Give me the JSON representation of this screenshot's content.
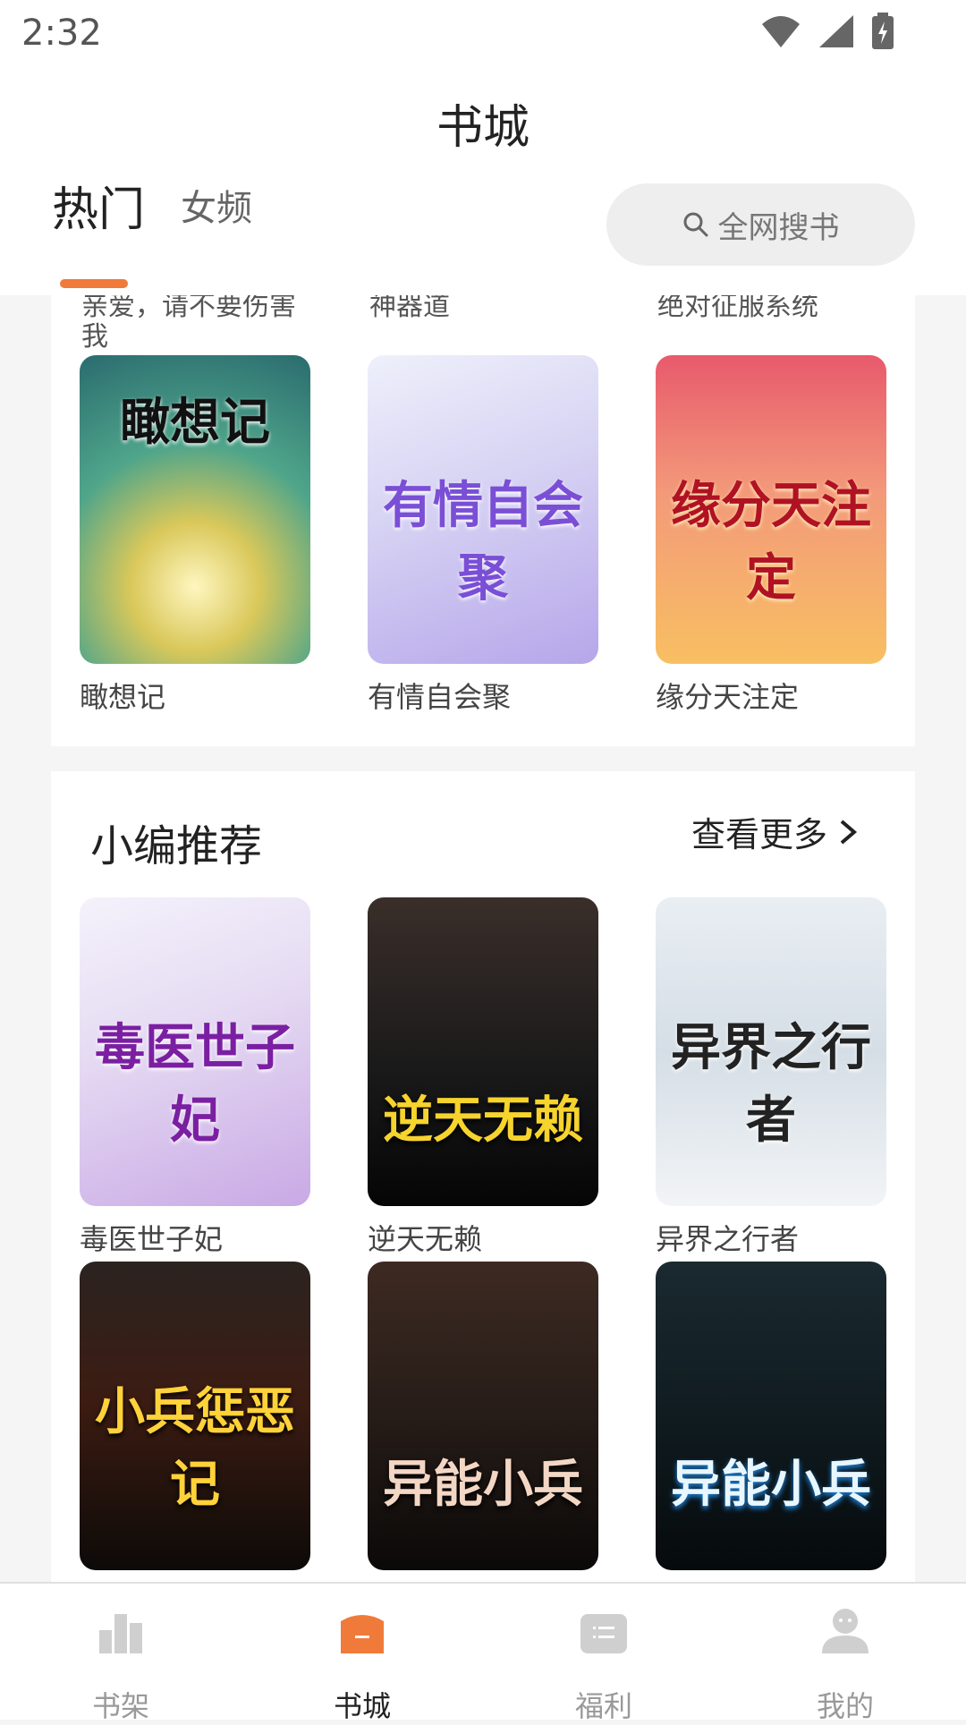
{
  "status": {
    "time": "2:32"
  },
  "header": {
    "title": "书城"
  },
  "tabs": [
    {
      "label": "热门",
      "active": true
    },
    {
      "label": "女频",
      "active": false
    }
  ],
  "search": {
    "label": "全网搜书"
  },
  "prev_section": {
    "partial_titles": [
      "亲爱，请不要伤害我",
      "神器道",
      "绝对征服系统"
    ],
    "books": [
      {
        "title": "瞰想记",
        "cover_text": "瞰想记"
      },
      {
        "title": "有情自会聚",
        "cover_text": "有情自会聚"
      },
      {
        "title": "缘分天注定",
        "cover_text": "缘分天注定"
      }
    ]
  },
  "editor_picks": {
    "title": "小编推荐",
    "more_label": "查看更多",
    "books": [
      {
        "title": "毒医世子妃",
        "cover_text": "毒医世子妃"
      },
      {
        "title": "逆天无赖",
        "cover_text": "逆天无赖"
      },
      {
        "title": "异界之行者",
        "cover_text": "异界之行者"
      },
      {
        "title": "",
        "cover_text": "小兵惩恶记"
      },
      {
        "title": "",
        "cover_text": "异能小兵"
      },
      {
        "title": "",
        "cover_text": "异能小兵"
      }
    ]
  },
  "bottom_nav": [
    {
      "label": "书架",
      "icon": "bookshelf-icon",
      "active": false
    },
    {
      "label": "书城",
      "icon": "bookstore-icon",
      "active": true
    },
    {
      "label": "福利",
      "icon": "gift-icon",
      "active": false
    },
    {
      "label": "我的",
      "icon": "profile-icon",
      "active": false
    }
  ],
  "colors": {
    "accent": "#f07a3a",
    "inactive": "#999999"
  }
}
